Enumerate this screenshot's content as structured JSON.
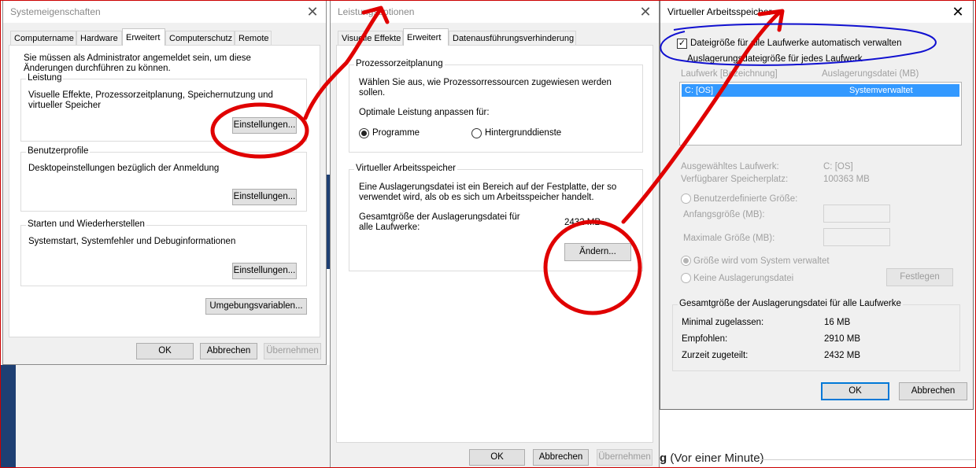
{
  "background": {
    "status_prefix": "g",
    "status_text": " (Vor einer Minute)"
  },
  "sysprops": {
    "title": "Systemeigenschaften",
    "tabs": [
      {
        "label": "Computername"
      },
      {
        "label": "Hardware"
      },
      {
        "label": "Erweitert"
      },
      {
        "label": "Computerschutz"
      },
      {
        "label": "Remote"
      }
    ],
    "admin_note": "Sie müssen als Administrator angemeldet sein, um diese Änderungen durchführen zu können.",
    "performance": {
      "label": "Leistung",
      "text": "Visuelle Effekte, Prozessorzeitplanung, Speichernutzung und virtueller Speicher",
      "button": "Einstellungen..."
    },
    "profiles": {
      "label": "Benutzerprofile",
      "text": "Desktopeinstellungen bezüglich der Anmeldung",
      "button": "Einstellungen..."
    },
    "startup": {
      "label": "Starten und Wiederherstellen",
      "text": "Systemstart, Systemfehler und Debuginformationen",
      "button": "Einstellungen..."
    },
    "env_button": "Umgebungsvariablen...",
    "ok": "OK",
    "cancel": "Abbrechen",
    "apply": "Übernehmen"
  },
  "perfopts": {
    "title": "Leistungsoptionen",
    "tabs": [
      {
        "label": "Visuelle Effekte"
      },
      {
        "label": "Erweitert"
      },
      {
        "label": "Datenausführungsverhinderung"
      }
    ],
    "scheduling": {
      "label": "Prozessorzeitplanung",
      "text": "Wählen Sie aus, wie Prozessorressourcen zugewiesen werden sollen.",
      "optimize": "Optimale Leistung anpassen für:",
      "programs": "Programme",
      "services": "Hintergrunddienste"
    },
    "vmem": {
      "label": "Virtueller Arbeitsspeicher",
      "text": "Eine Auslagerungsdatei ist ein Bereich auf der Festplatte, der so verwendet wird, als ob es sich um Arbeitsspeicher handelt.",
      "total_label": "Gesamtgröße der Auslagerungsdatei für alle Laufwerke:",
      "total_value": "2432 MB",
      "change_button": "Ändern..."
    },
    "ok": "OK",
    "cancel": "Abbrechen",
    "apply": "Übernehmen"
  },
  "virtmem": {
    "title": "Virtueller Arbeitsspeicher",
    "auto_manage": "Dateigröße für alle Laufwerke automatisch verwalten",
    "per_drive_label": "Auslagerungsdateigröße für jedes Laufwerk",
    "col_drive": "Laufwerk [Bezeichnung]",
    "col_pagefile": "Auslagerungsdatei (MB)",
    "drive_row_drive": "C:      [OS]",
    "drive_row_size": "Systemverwaltet",
    "selected_drive_label": "Ausgewähltes Laufwerk:",
    "selected_drive_value": "C:  [OS]",
    "free_space_label": "Verfügbarer Speicherplatz:",
    "free_space_value": "100363 MB",
    "custom_size": "Benutzerdefinierte Größe:",
    "initial_size": "Anfangsgröße (MB):",
    "max_size": "Maximale Größe (MB):",
    "system_managed": "Größe wird vom System verwaltet",
    "no_pagefile": "Keine Auslagerungsdatei",
    "set_button": "Festlegen",
    "totals_label": "Gesamtgröße der Auslagerungsdatei für alle Laufwerke",
    "min_label": "Minimal zugelassen:",
    "min_value": "16 MB",
    "recommended_label": "Empfohlen:",
    "recommended_value": "2910 MB",
    "current_label": "Zurzeit zugeteilt:",
    "current_value": "2432 MB",
    "ok": "OK",
    "cancel": "Abbrechen"
  },
  "colors": {
    "annotation_red": "#e00000",
    "annotation_blue": "#1010d0",
    "selection_blue": "#3399ff",
    "default_button_border": "#0078d7"
  }
}
